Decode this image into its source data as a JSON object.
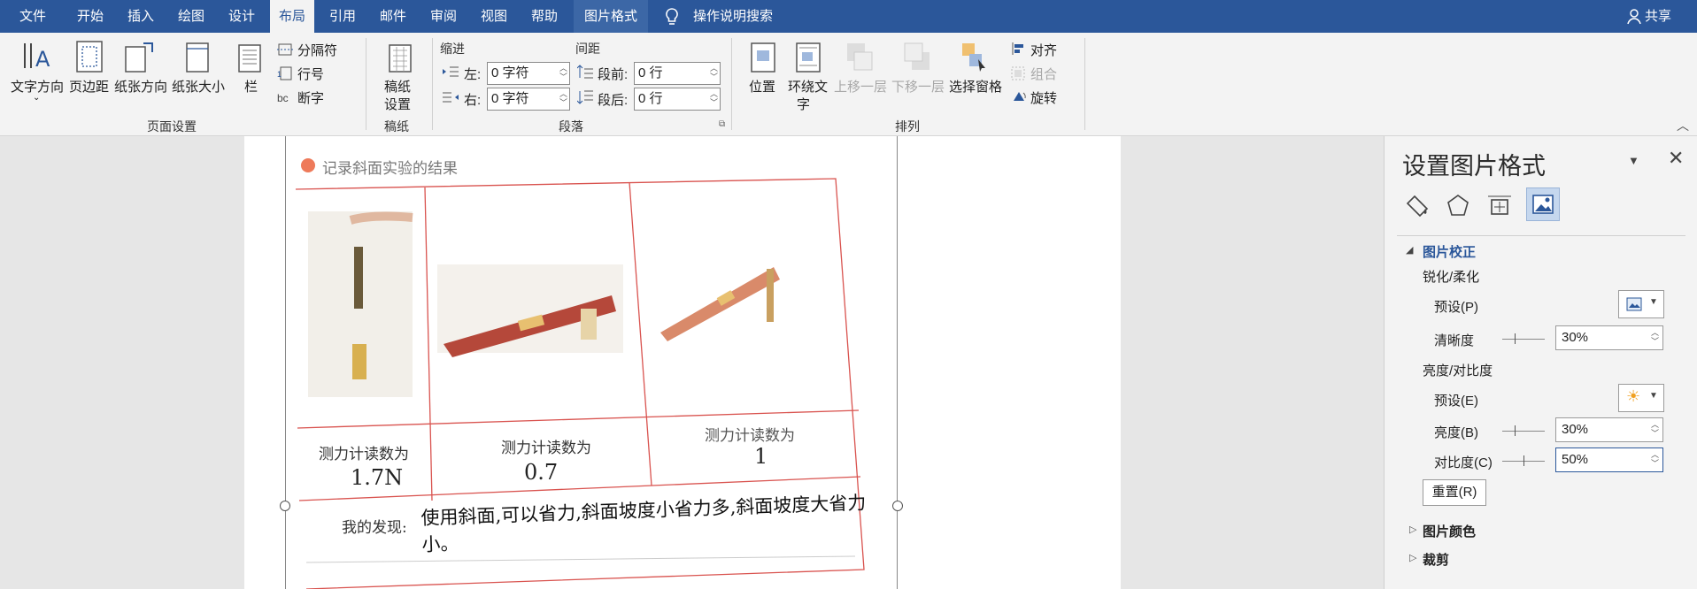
{
  "menu": {
    "tabs": [
      "文件",
      "开始",
      "插入",
      "绘图",
      "设计",
      "布局",
      "引用",
      "邮件",
      "审阅",
      "视图",
      "帮助",
      "图片格式"
    ],
    "search": "操作说明搜索",
    "share": "共享"
  },
  "ribbon": {
    "page_setup": {
      "text_direction": "文字方向",
      "margins": "页边距",
      "orientation": "纸张方向",
      "size": "纸张大小",
      "columns": "栏",
      "breaks": "分隔符",
      "line_numbers": "行号",
      "hyphenation": "断字",
      "group_label": "页面设置"
    },
    "manuscript": {
      "btn_line1": "稿纸",
      "btn_line2": "设置",
      "group_label": "稿纸"
    },
    "paragraph": {
      "indent_title": "缩进",
      "spacing_title": "间距",
      "left_label": "左:",
      "left_value": "0 字符",
      "right_label": "右:",
      "right_value": "0 字符",
      "before_label": "段前:",
      "before_value": "0 行",
      "after_label": "段后:",
      "after_value": "0 行",
      "group_label": "段落"
    },
    "arrange": {
      "position": "位置",
      "wrap_line1": "环绕文",
      "wrap_line2": "字",
      "bring_forward": "上移一层",
      "send_backward": "下移一层",
      "selection_pane": "选择窗格",
      "align": "对齐",
      "group": "组合",
      "rotate": "旋转",
      "group_label": "排列"
    }
  },
  "document": {
    "heading": "记录斜面实验的结果",
    "cell1": "测力计读数为",
    "val1": "1.7N",
    "cell2": "测力计读数为",
    "val2": "0.7",
    "cell3": "测力计读数为",
    "val3": "1",
    "finding_label": "我的发现:",
    "finding_text": "使用斜面,可以省力,斜面坡度小省力多,斜面坡度大省力小。"
  },
  "pane": {
    "title": "设置图片格式",
    "section_correction": "图片校正",
    "sharpen_soften": "锐化/柔化",
    "preset1_label": "预设(P)",
    "sharpness_label": "清晰度",
    "sharpness_value": "30%",
    "sharpness_level": 0.3,
    "bright_contrast": "亮度/对比度",
    "preset2_label": "预设(E)",
    "brightness_label": "亮度(B)",
    "brightness_value": "30%",
    "brightness_level": 0.3,
    "contrast_label": "对比度(C)",
    "contrast_value": "50%",
    "contrast_level": 0.5,
    "reset_label": "重置(R)",
    "section_color": "图片颜色",
    "section_crop": "裁剪"
  },
  "colors": {
    "accent": "#2b579a",
    "doc_red": "#d9534f"
  }
}
